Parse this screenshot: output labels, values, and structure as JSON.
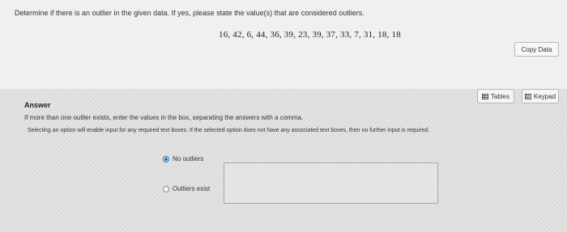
{
  "question": {
    "prompt": "Determine if there is an outlier in the given data. If yes, please state the value(s) that are considered outliers.",
    "data_values": "16, 42, 6, 44, 36, 39, 23, 39, 37, 33, 7, 31, 18, 18"
  },
  "toolbar": {
    "copy_data_label": "Copy Data",
    "tables_label": "Tables",
    "keypad_label": "Keypad"
  },
  "answer": {
    "heading": "Answer",
    "instruction": "If more than one outlier exists, enter the values in the box, separating the answers with a comma.",
    "selection_note": "Selecting an option will enable input for any required text boxes. If the selected option does not have any associated text boxes, then no further input is required.",
    "options": [
      {
        "label": "No outliers",
        "selected": true
      },
      {
        "label": "Outliers exist",
        "selected": false
      }
    ],
    "outliers_input_value": ""
  },
  "colors": {
    "radio_selected": "#1e6fb8"
  }
}
